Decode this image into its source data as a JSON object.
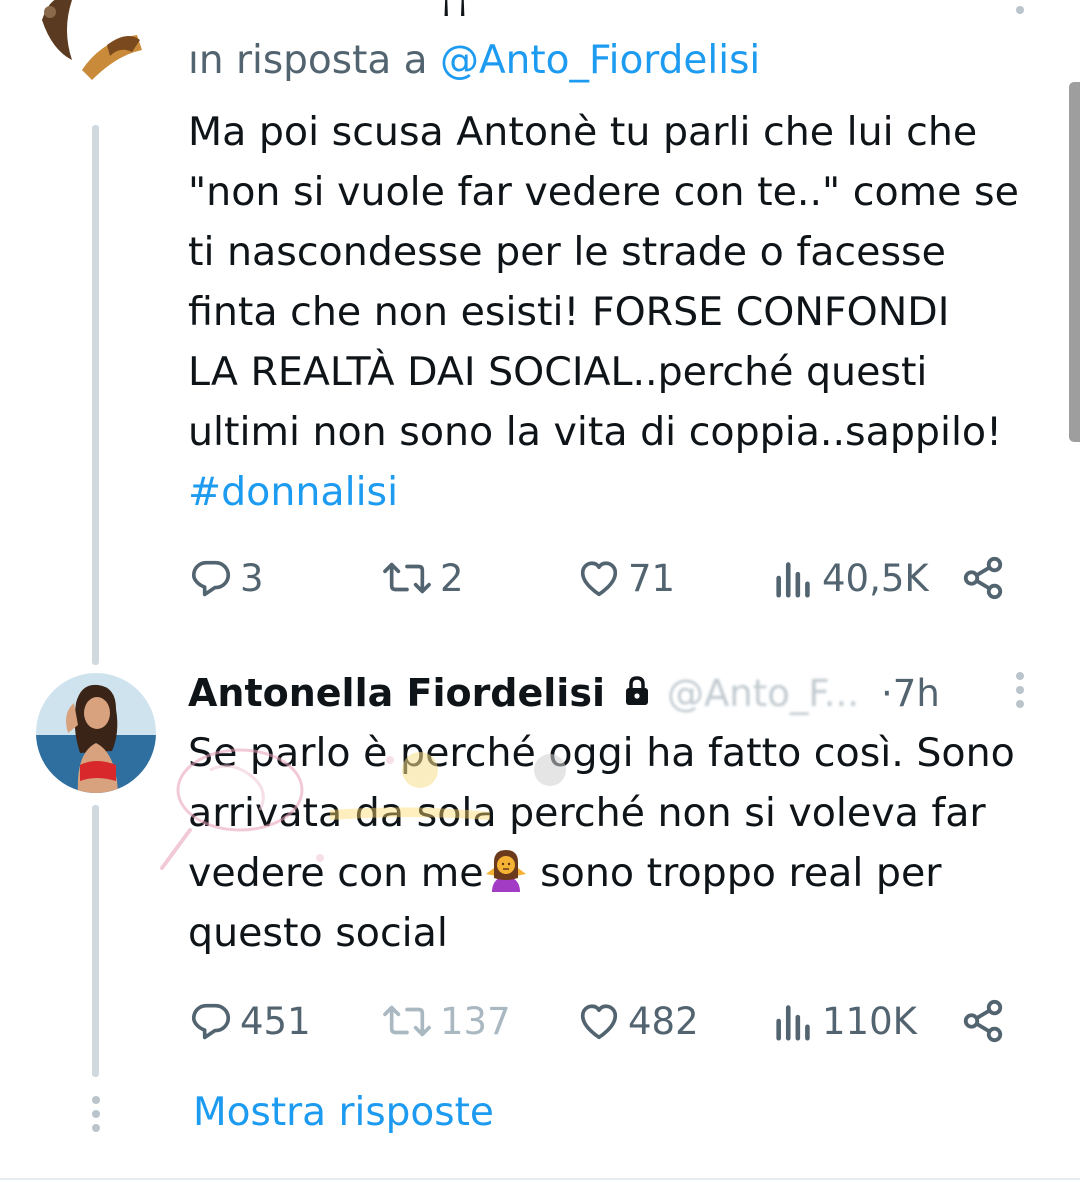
{
  "colors": {
    "accent": "#1d9bf0",
    "text_primary": "#0f1419",
    "text_secondary": "#536471",
    "thread_line": "#cfd9de"
  },
  "top_tweet": {
    "cut_header_text": "ʻʼ ʻ ˈ  ⸶⸷  ",
    "reply_prefix": "ın risposta a",
    "reply_mention": "@Anto_Fiordelisi",
    "text_lines": [
      "Ma poi scusa Antonè tu parli che lui che",
      "\"non si vuole far vedere con te..\" come se",
      "ti nascondesse per le strade o facesse",
      "finta che non esisti! FORSE CONFONDI",
      "LA REALTÀ DAI SOCIAL..perché questi",
      "ultimi non sono la vita di coppia..sappilo!"
    ],
    "hashtag": "#donnalisi",
    "actions": {
      "replies": "3",
      "retweets": "2",
      "likes": "71",
      "views": "40,5K"
    }
  },
  "reply_tweet": {
    "display_name": "Antonella Fiordelisi",
    "handle": "@Anto_F...",
    "time_separator": "·",
    "time": "7h",
    "text_lines": [
      "Se parlo è perché oggi ha fatto così. Sono",
      "arrivata da sola perché non si voleva far"
    ],
    "line3_before_emoji": "vedere con me",
    "emoji_name": "person-shrugging-emoji",
    "line3_after_emoji": " sono troppo real per",
    "line4": "questo social",
    "actions": {
      "replies": "451",
      "retweets": "137",
      "likes": "482",
      "views": "110K"
    }
  },
  "show_replies_label": "Mostra risposte"
}
